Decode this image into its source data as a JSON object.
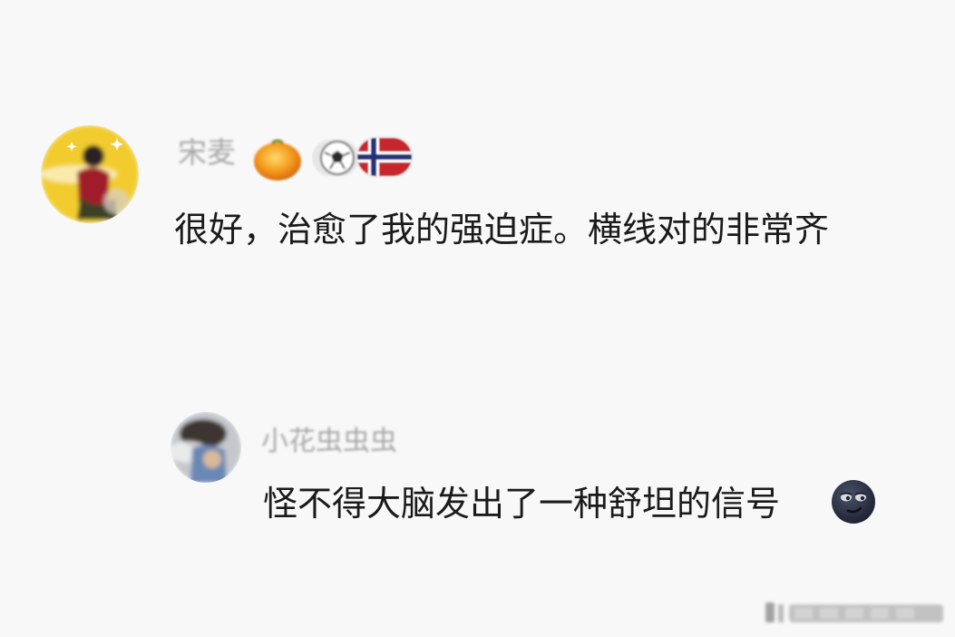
{
  "comments": [
    {
      "username": "宋麦",
      "text": "很好，治愈了我的强迫症。横线对的非常齐",
      "avatar": "user-avatar-image",
      "badges": [
        "orange-badge-icon",
        "soccer-ball-icon",
        "norway-flag-icon"
      ]
    },
    {
      "username": "小花虫虫虫",
      "text": "怪不得大脑发出了一种舒坦的信号",
      "emoji": "smirk-emoji-icon",
      "avatar": "user-avatar-image"
    }
  ],
  "colors": {
    "background": "#f8f8f8",
    "text": "#1a1a1a",
    "username": "#a8a8a8",
    "avatar_ring": "#f2cc2e"
  }
}
